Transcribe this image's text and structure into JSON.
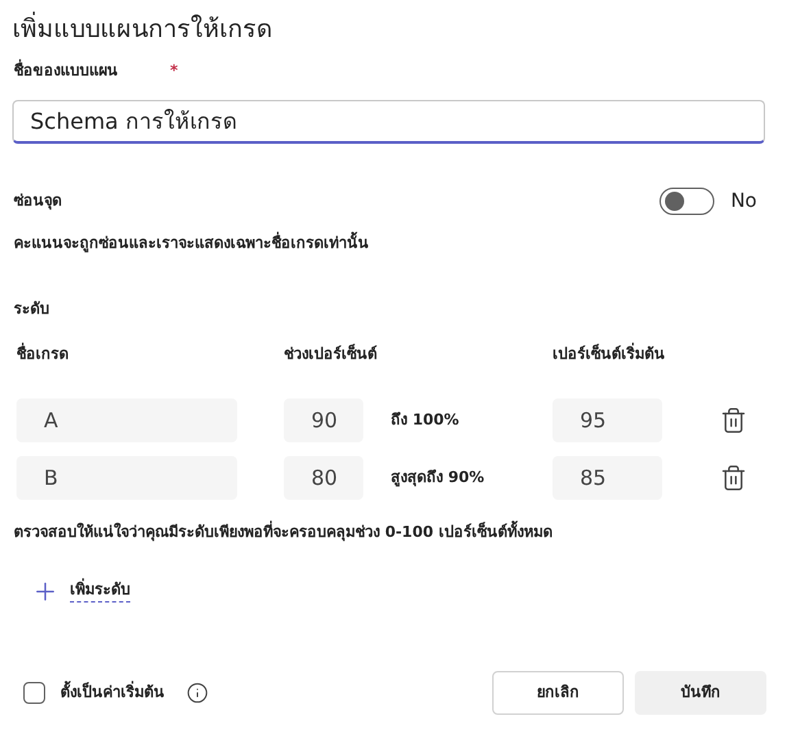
{
  "title": "เพิ่มแบบแผนการให้เกรด",
  "name_field": {
    "label": "ชื่อของแบบแผน",
    "required_mark": "*",
    "value": "Schema การให้เกรด"
  },
  "hide_points": {
    "label": "ซ่อนจุด",
    "on": false,
    "state_text": "No",
    "description": "คะแนนจะถูกซ่อนและเราจะแสดงเฉพาะชื่อเกรดเท่านั้น"
  },
  "levels": {
    "title": "ระดับ",
    "columns": [
      "ชื่อเกรด",
      "ช่วงเปอร์เซ็นต์",
      "เปอร์เซ็นต์เริ่มต้น"
    ],
    "rows": [
      {
        "name": "A",
        "range_value": "90",
        "range_text": "ถึง 100%",
        "start": "95"
      },
      {
        "name": "B",
        "range_value": "80",
        "range_text": "สูงสุดถึง 90%",
        "start": "85"
      }
    ],
    "note": "ตรวจสอบให้แน่ใจว่าคุณมีระดับเพียงพอที่จะครอบคลุมช่วง 0-100 เปอร์เซ็นต์ทั้งหมด",
    "add_button": "เพิ่มระดับ"
  },
  "footer": {
    "default_checkbox": {
      "label": "ตั้งเป็นค่าเริ่มต้น",
      "checked": false
    },
    "buttons": [
      "ยกเลิก",
      "บันทึก"
    ]
  }
}
